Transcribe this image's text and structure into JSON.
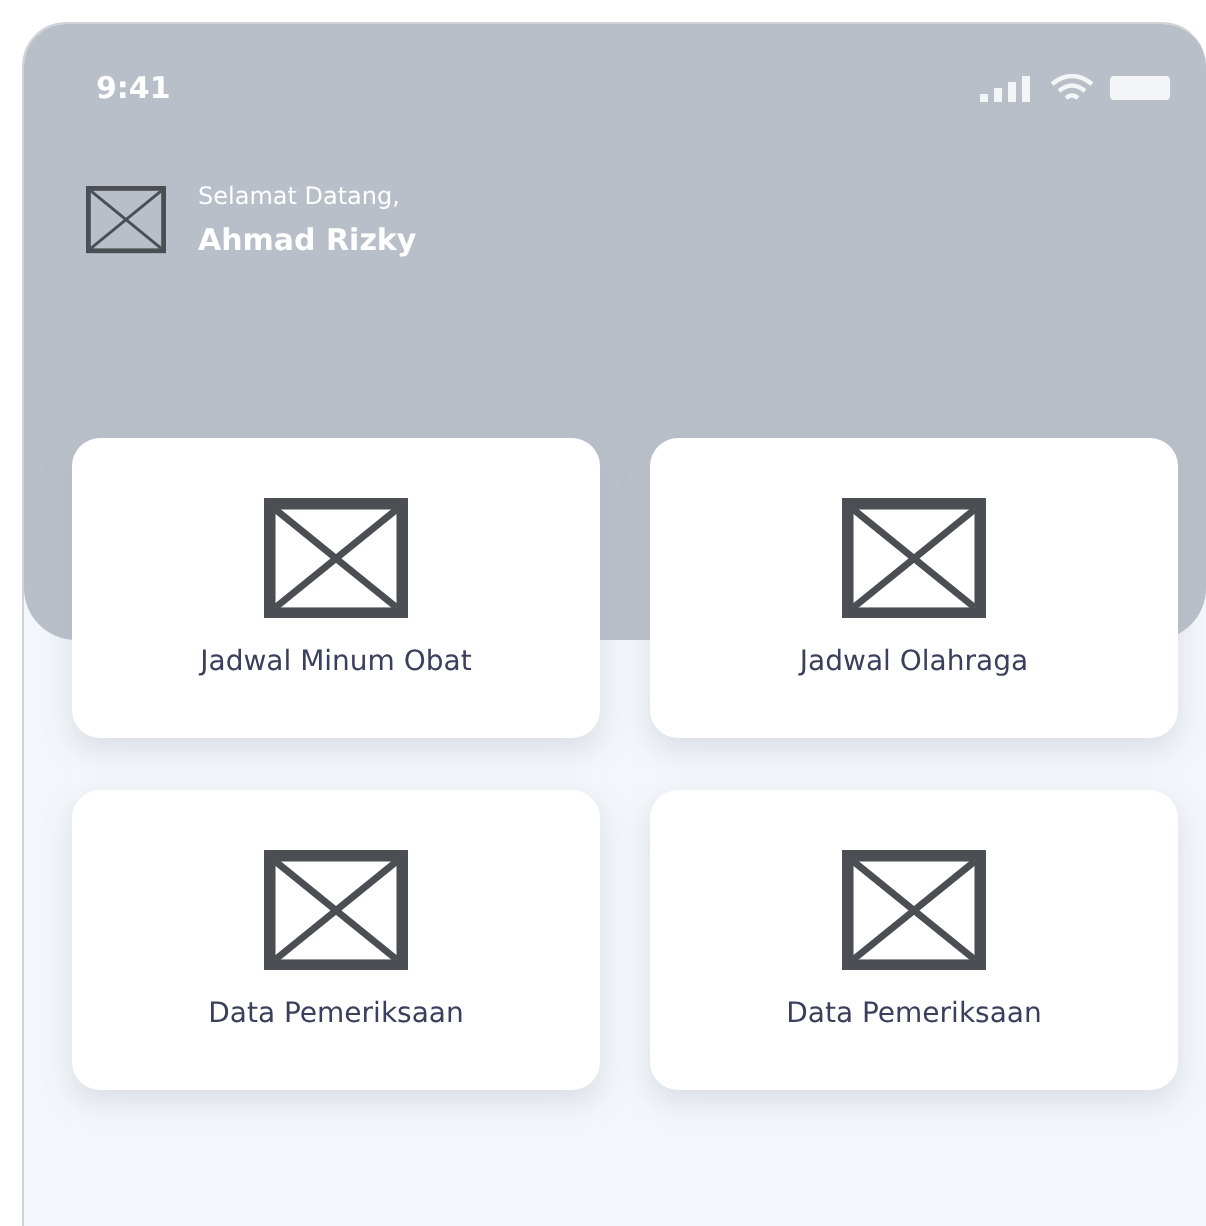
{
  "status_bar": {
    "time": "9:41"
  },
  "greeting": {
    "subtitle": "Selamat Datang,",
    "name": "Ahmad Rizky"
  },
  "menu": [
    {
      "label": "Jadwal Minum Obat"
    },
    {
      "label": "Jadwal Olahraga"
    },
    {
      "label": "Data Pemeriksaan"
    },
    {
      "label": "Data Pemeriksaan"
    }
  ]
}
